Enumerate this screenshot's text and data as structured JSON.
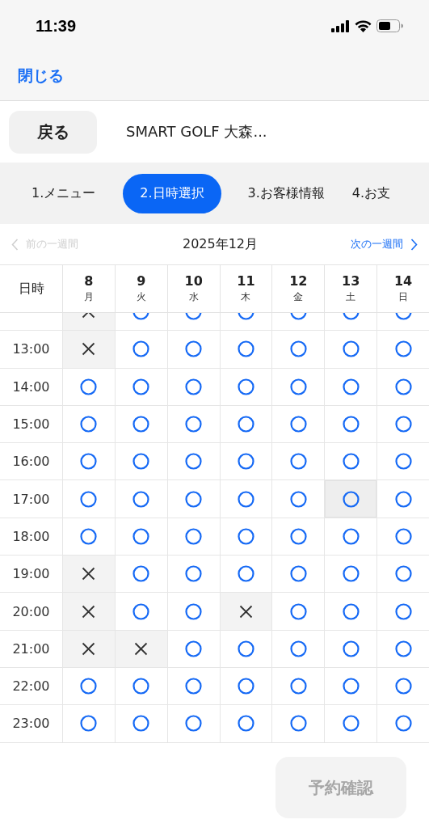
{
  "status_bar": {
    "time": "11:39"
  },
  "nav": {
    "close": "閉じる"
  },
  "header": {
    "back": "戻る",
    "title": "SMART GOLF 大森..."
  },
  "steps": [
    {
      "label": "1.メニュー",
      "selected": false
    },
    {
      "label": "2.日時選択",
      "selected": true
    },
    {
      "label": "3.お客様情報",
      "selected": false
    },
    {
      "label": "4.お支",
      "selected": false
    }
  ],
  "week_nav": {
    "prev": {
      "label": "前の一週間",
      "disabled": true
    },
    "month": "2025年12月",
    "next": {
      "label": "次の一週間",
      "disabled": false
    }
  },
  "table": {
    "corner": "日時",
    "days": [
      {
        "date": "8",
        "weekday": "月"
      },
      {
        "date": "9",
        "weekday": "火"
      },
      {
        "date": "10",
        "weekday": "水"
      },
      {
        "date": "11",
        "weekday": "木"
      },
      {
        "date": "12",
        "weekday": "金"
      },
      {
        "date": "13",
        "weekday": "土"
      },
      {
        "date": "14",
        "weekday": "日"
      }
    ],
    "rows": [
      {
        "slots": [
          {
            "kind": "full",
            "selected": false
          },
          {
            "kind": "open",
            "selected": false
          },
          {
            "kind": "open",
            "selected": false
          },
          {
            "kind": "open",
            "selected": false
          },
          {
            "kind": "open",
            "selected": false
          },
          {
            "kind": "open",
            "selected": false
          },
          {
            "kind": "open",
            "selected": false
          }
        ]
      },
      {
        "time": "13:00",
        "slots": [
          {
            "kind": "full",
            "selected": false
          },
          {
            "kind": "open",
            "selected": false
          },
          {
            "kind": "open",
            "selected": false
          },
          {
            "kind": "open",
            "selected": false
          },
          {
            "kind": "open",
            "selected": false
          },
          {
            "kind": "open",
            "selected": false
          },
          {
            "kind": "open",
            "selected": false
          }
        ]
      },
      {
        "time": "14:00",
        "slots": [
          {
            "kind": "open",
            "selected": false
          },
          {
            "kind": "open",
            "selected": false
          },
          {
            "kind": "open",
            "selected": false
          },
          {
            "kind": "open",
            "selected": false
          },
          {
            "kind": "open",
            "selected": false
          },
          {
            "kind": "open",
            "selected": false
          },
          {
            "kind": "open",
            "selected": false
          }
        ]
      },
      {
        "time": "15:00",
        "slots": [
          {
            "kind": "open",
            "selected": false
          },
          {
            "kind": "open",
            "selected": false
          },
          {
            "kind": "open",
            "selected": false
          },
          {
            "kind": "open",
            "selected": false
          },
          {
            "kind": "open",
            "selected": false
          },
          {
            "kind": "open",
            "selected": false
          },
          {
            "kind": "open",
            "selected": false
          }
        ]
      },
      {
        "time": "16:00",
        "slots": [
          {
            "kind": "open",
            "selected": false
          },
          {
            "kind": "open",
            "selected": false
          },
          {
            "kind": "open",
            "selected": false
          },
          {
            "kind": "open",
            "selected": false
          },
          {
            "kind": "open",
            "selected": false
          },
          {
            "kind": "open",
            "selected": false
          },
          {
            "kind": "open",
            "selected": false
          }
        ]
      },
      {
        "time": "17:00",
        "slots": [
          {
            "kind": "open",
            "selected": false
          },
          {
            "kind": "open",
            "selected": false
          },
          {
            "kind": "open",
            "selected": false
          },
          {
            "kind": "open",
            "selected": false
          },
          {
            "kind": "open",
            "selected": false
          },
          {
            "kind": "open",
            "selected": true
          },
          {
            "kind": "open",
            "selected": false
          }
        ]
      },
      {
        "time": "18:00",
        "slots": [
          {
            "kind": "open",
            "selected": false
          },
          {
            "kind": "open",
            "selected": false
          },
          {
            "kind": "open",
            "selected": false
          },
          {
            "kind": "open",
            "selected": false
          },
          {
            "kind": "open",
            "selected": false
          },
          {
            "kind": "open",
            "selected": false
          },
          {
            "kind": "open",
            "selected": false
          }
        ]
      },
      {
        "time": "19:00",
        "slots": [
          {
            "kind": "full",
            "selected": false
          },
          {
            "kind": "open",
            "selected": false
          },
          {
            "kind": "open",
            "selected": false
          },
          {
            "kind": "open",
            "selected": false
          },
          {
            "kind": "open",
            "selected": false
          },
          {
            "kind": "open",
            "selected": false
          },
          {
            "kind": "open",
            "selected": false
          }
        ]
      },
      {
        "time": "20:00",
        "slots": [
          {
            "kind": "full",
            "selected": false
          },
          {
            "kind": "open",
            "selected": false
          },
          {
            "kind": "open",
            "selected": false
          },
          {
            "kind": "full",
            "selected": false
          },
          {
            "kind": "open",
            "selected": false
          },
          {
            "kind": "open",
            "selected": false
          },
          {
            "kind": "open",
            "selected": false
          }
        ]
      },
      {
        "time": "21:00",
        "slots": [
          {
            "kind": "full",
            "selected": false
          },
          {
            "kind": "full",
            "selected": false
          },
          {
            "kind": "open",
            "selected": false
          },
          {
            "kind": "open",
            "selected": false
          },
          {
            "kind": "open",
            "selected": false
          },
          {
            "kind": "open",
            "selected": false
          },
          {
            "kind": "open",
            "selected": false
          }
        ]
      },
      {
        "time": "22:00",
        "slots": [
          {
            "kind": "open",
            "selected": false
          },
          {
            "kind": "open",
            "selected": false
          },
          {
            "kind": "open",
            "selected": false
          },
          {
            "kind": "open",
            "selected": false
          },
          {
            "kind": "open",
            "selected": false
          },
          {
            "kind": "open",
            "selected": false
          },
          {
            "kind": "open",
            "selected": false
          }
        ]
      },
      {
        "time": "23:00",
        "slots": [
          {
            "kind": "open",
            "selected": false
          },
          {
            "kind": "open",
            "selected": false
          },
          {
            "kind": "open",
            "selected": false
          },
          {
            "kind": "open",
            "selected": false
          },
          {
            "kind": "open",
            "selected": false
          },
          {
            "kind": "open",
            "selected": false
          },
          {
            "kind": "open",
            "selected": false
          }
        ]
      }
    ]
  },
  "confirm": {
    "label": "予約確認",
    "disabled": true
  }
}
